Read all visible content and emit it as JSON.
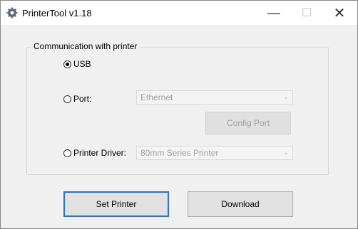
{
  "window": {
    "title": "PrinterTool v1.18",
    "controls": {
      "minimize": "—",
      "maximize": "☐",
      "close": "✕"
    }
  },
  "group": {
    "legend": "Communication with printer",
    "usb": {
      "label": "USB",
      "checked": true
    },
    "port": {
      "label": "Port:",
      "checked": false,
      "selected": "Ethernet"
    },
    "config_port": {
      "label": "Config Port"
    },
    "driver": {
      "label": "Printer Driver:",
      "checked": false,
      "selected": "80mm Series Printer"
    }
  },
  "buttons": {
    "set_printer": "Set Printer",
    "download": "Download"
  },
  "icons": {
    "chevron": "⌄",
    "app": "gear-icon"
  },
  "colors": {
    "focus_border": "#2b6fc9",
    "disabled_text": "#a0a0a0"
  }
}
